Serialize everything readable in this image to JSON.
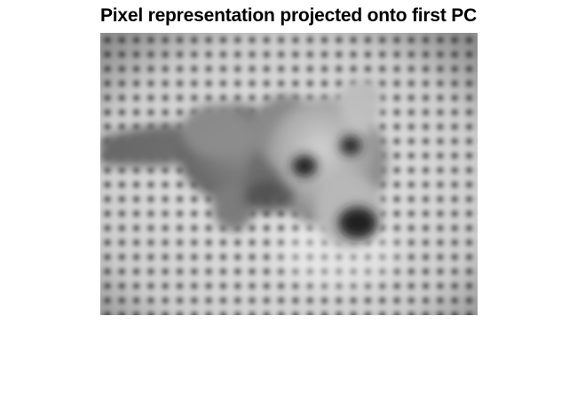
{
  "figure": {
    "title": "Pixel representation projected onto first PC",
    "colormap": "grayscale",
    "image_subject": "blurred-grayscale-dog-on-grid-floor"
  },
  "colors": {
    "background": "#ffffff",
    "title_text": "#000000",
    "floor_light": "#e6e6e6",
    "grid_dot": "#4a4a4a",
    "dog_body": "#9a9a9a",
    "dog_dark": "#222222"
  }
}
